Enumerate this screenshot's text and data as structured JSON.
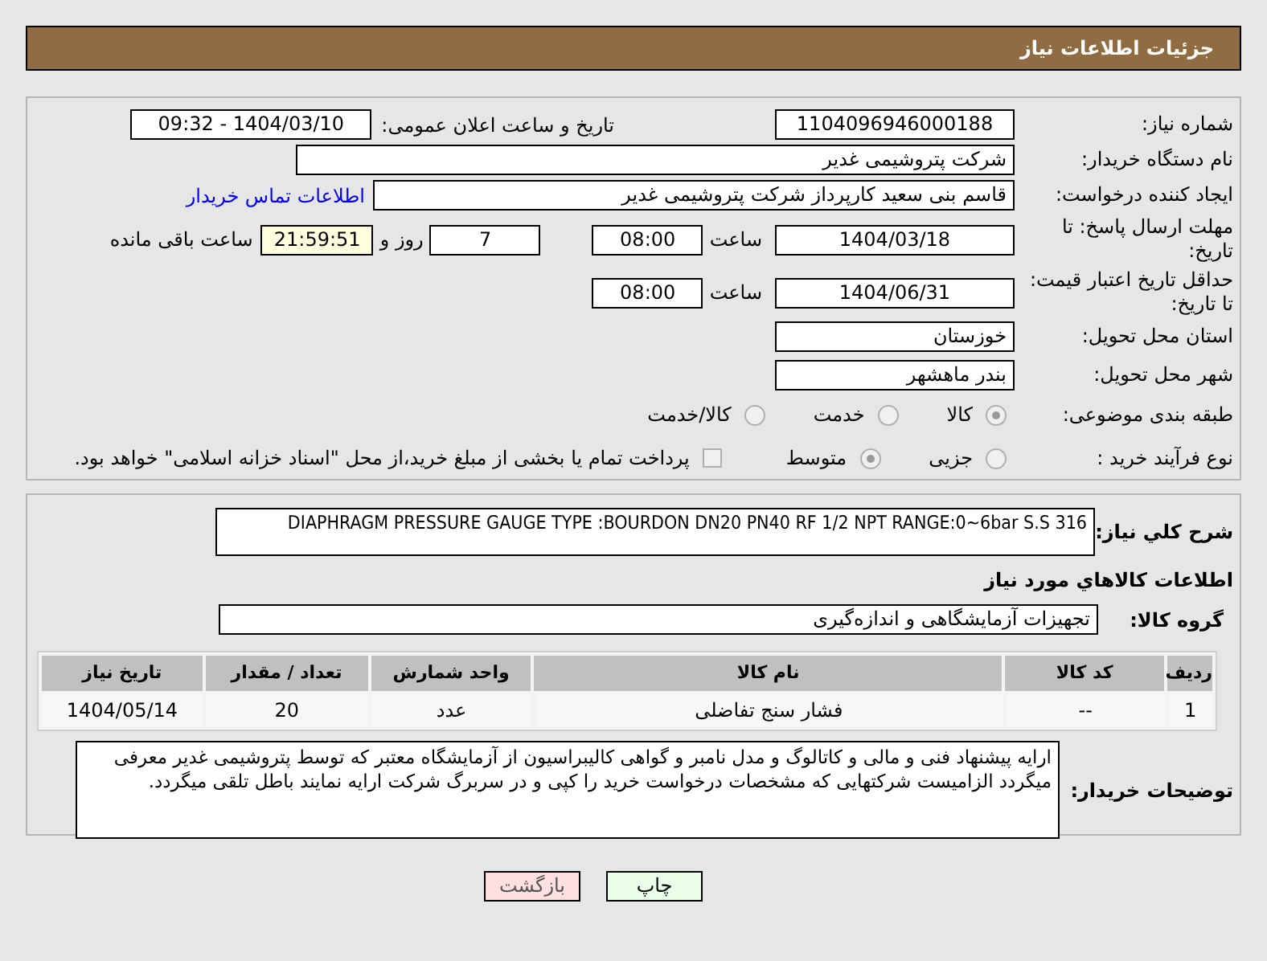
{
  "page_title": "جزئیات اطلاعات نیاز",
  "need_number": {
    "label": "شماره نیاز:",
    "value": "1104096946000188"
  },
  "announce": {
    "label": "تاریخ و ساعت اعلان عمومی:",
    "value": "1404/03/10 - 09:32"
  },
  "buyer": {
    "label": "نام دستگاه خریدار:",
    "value": "شرکت پتروشیمی غدیر"
  },
  "creator": {
    "label": "ایجاد کننده درخواست:",
    "value": "قاسم بنی سعید کارپرداز شرکت پتروشیمی غدیر",
    "link": "اطلاعات تماس خریدار"
  },
  "reply_deadline": {
    "label": "مهلت ارسال پاسخ: تا تاریخ:",
    "date": "1404/03/18",
    "time_label": "ساعت",
    "time": "08:00",
    "days": "7",
    "days_label": "روز و",
    "remaining": "21:59:51",
    "remaining_label": "ساعت باقی مانده"
  },
  "price_validity": {
    "label": "حداقل تاریخ اعتبار قیمت: تا تاریخ:",
    "date": "1404/06/31",
    "time_label": "ساعت",
    "time": "08:00"
  },
  "province": {
    "label": "استان محل تحویل:",
    "value": "خوزستان"
  },
  "city": {
    "label": "شهر محل تحویل:",
    "value": "بندر ماهشهر"
  },
  "category": {
    "label": "طبقه بندی موضوعی:",
    "options": [
      {
        "label": "کالا",
        "selected": true
      },
      {
        "label": "خدمت",
        "selected": false
      },
      {
        "label": "کالا/خدمت",
        "selected": false
      }
    ]
  },
  "purchase_type": {
    "label": "نوع فرآیند خرید :",
    "options": [
      {
        "label": "جزیی",
        "selected": false
      },
      {
        "label": "متوسط",
        "selected": true
      }
    ],
    "payment": {
      "label": "پرداخت تمام یا بخشی از مبلغ خرید،از محل \"اسناد خزانه اسلامی\" خواهد بود.",
      "checked": false
    }
  },
  "description": {
    "label": "شرح کلي نياز:",
    "value": "DIAPHRAGM PRESSURE GAUGE TYPE :BOURDON DN20 PN40 RF 1/2 NPT RANGE:0~6bar S.S 316"
  },
  "goods_title": "اطلاعات کالاهاي مورد نياز",
  "goods_group": {
    "label": "گروه کالا:",
    "value": "تجهیزات آزمایشگاهی و اندازه‌گیری"
  },
  "table": {
    "columns": [
      "ردیف",
      "کد کالا",
      "نام کالا",
      "واحد شمارش",
      "تعداد / مقدار",
      "تاریخ نیاز"
    ],
    "rows": [
      [
        "1",
        "--",
        "فشار سنج تفاضلی",
        "عدد",
        "20",
        "1404/05/14"
      ]
    ]
  },
  "buyer_notes": {
    "label": "توضیحات خریدار:",
    "value": "ارایه پیشنهاد فنی و مالی و کاتالوگ و مدل نامبر و گواهی کالیبراسیون از آزمایشگاه معتبر که توسط پتروشیمی غدیر معرفی میگردد الزامیست شرکتهایی که مشخصات درخواست خرید را کپی و در سربرگ شرکت ارایه نمایند باطل تلقی میگردد."
  },
  "buttons": [
    {
      "label": "چاپ",
      "kind": "print"
    },
    {
      "label": "بازگشت",
      "kind": "back"
    }
  ]
}
